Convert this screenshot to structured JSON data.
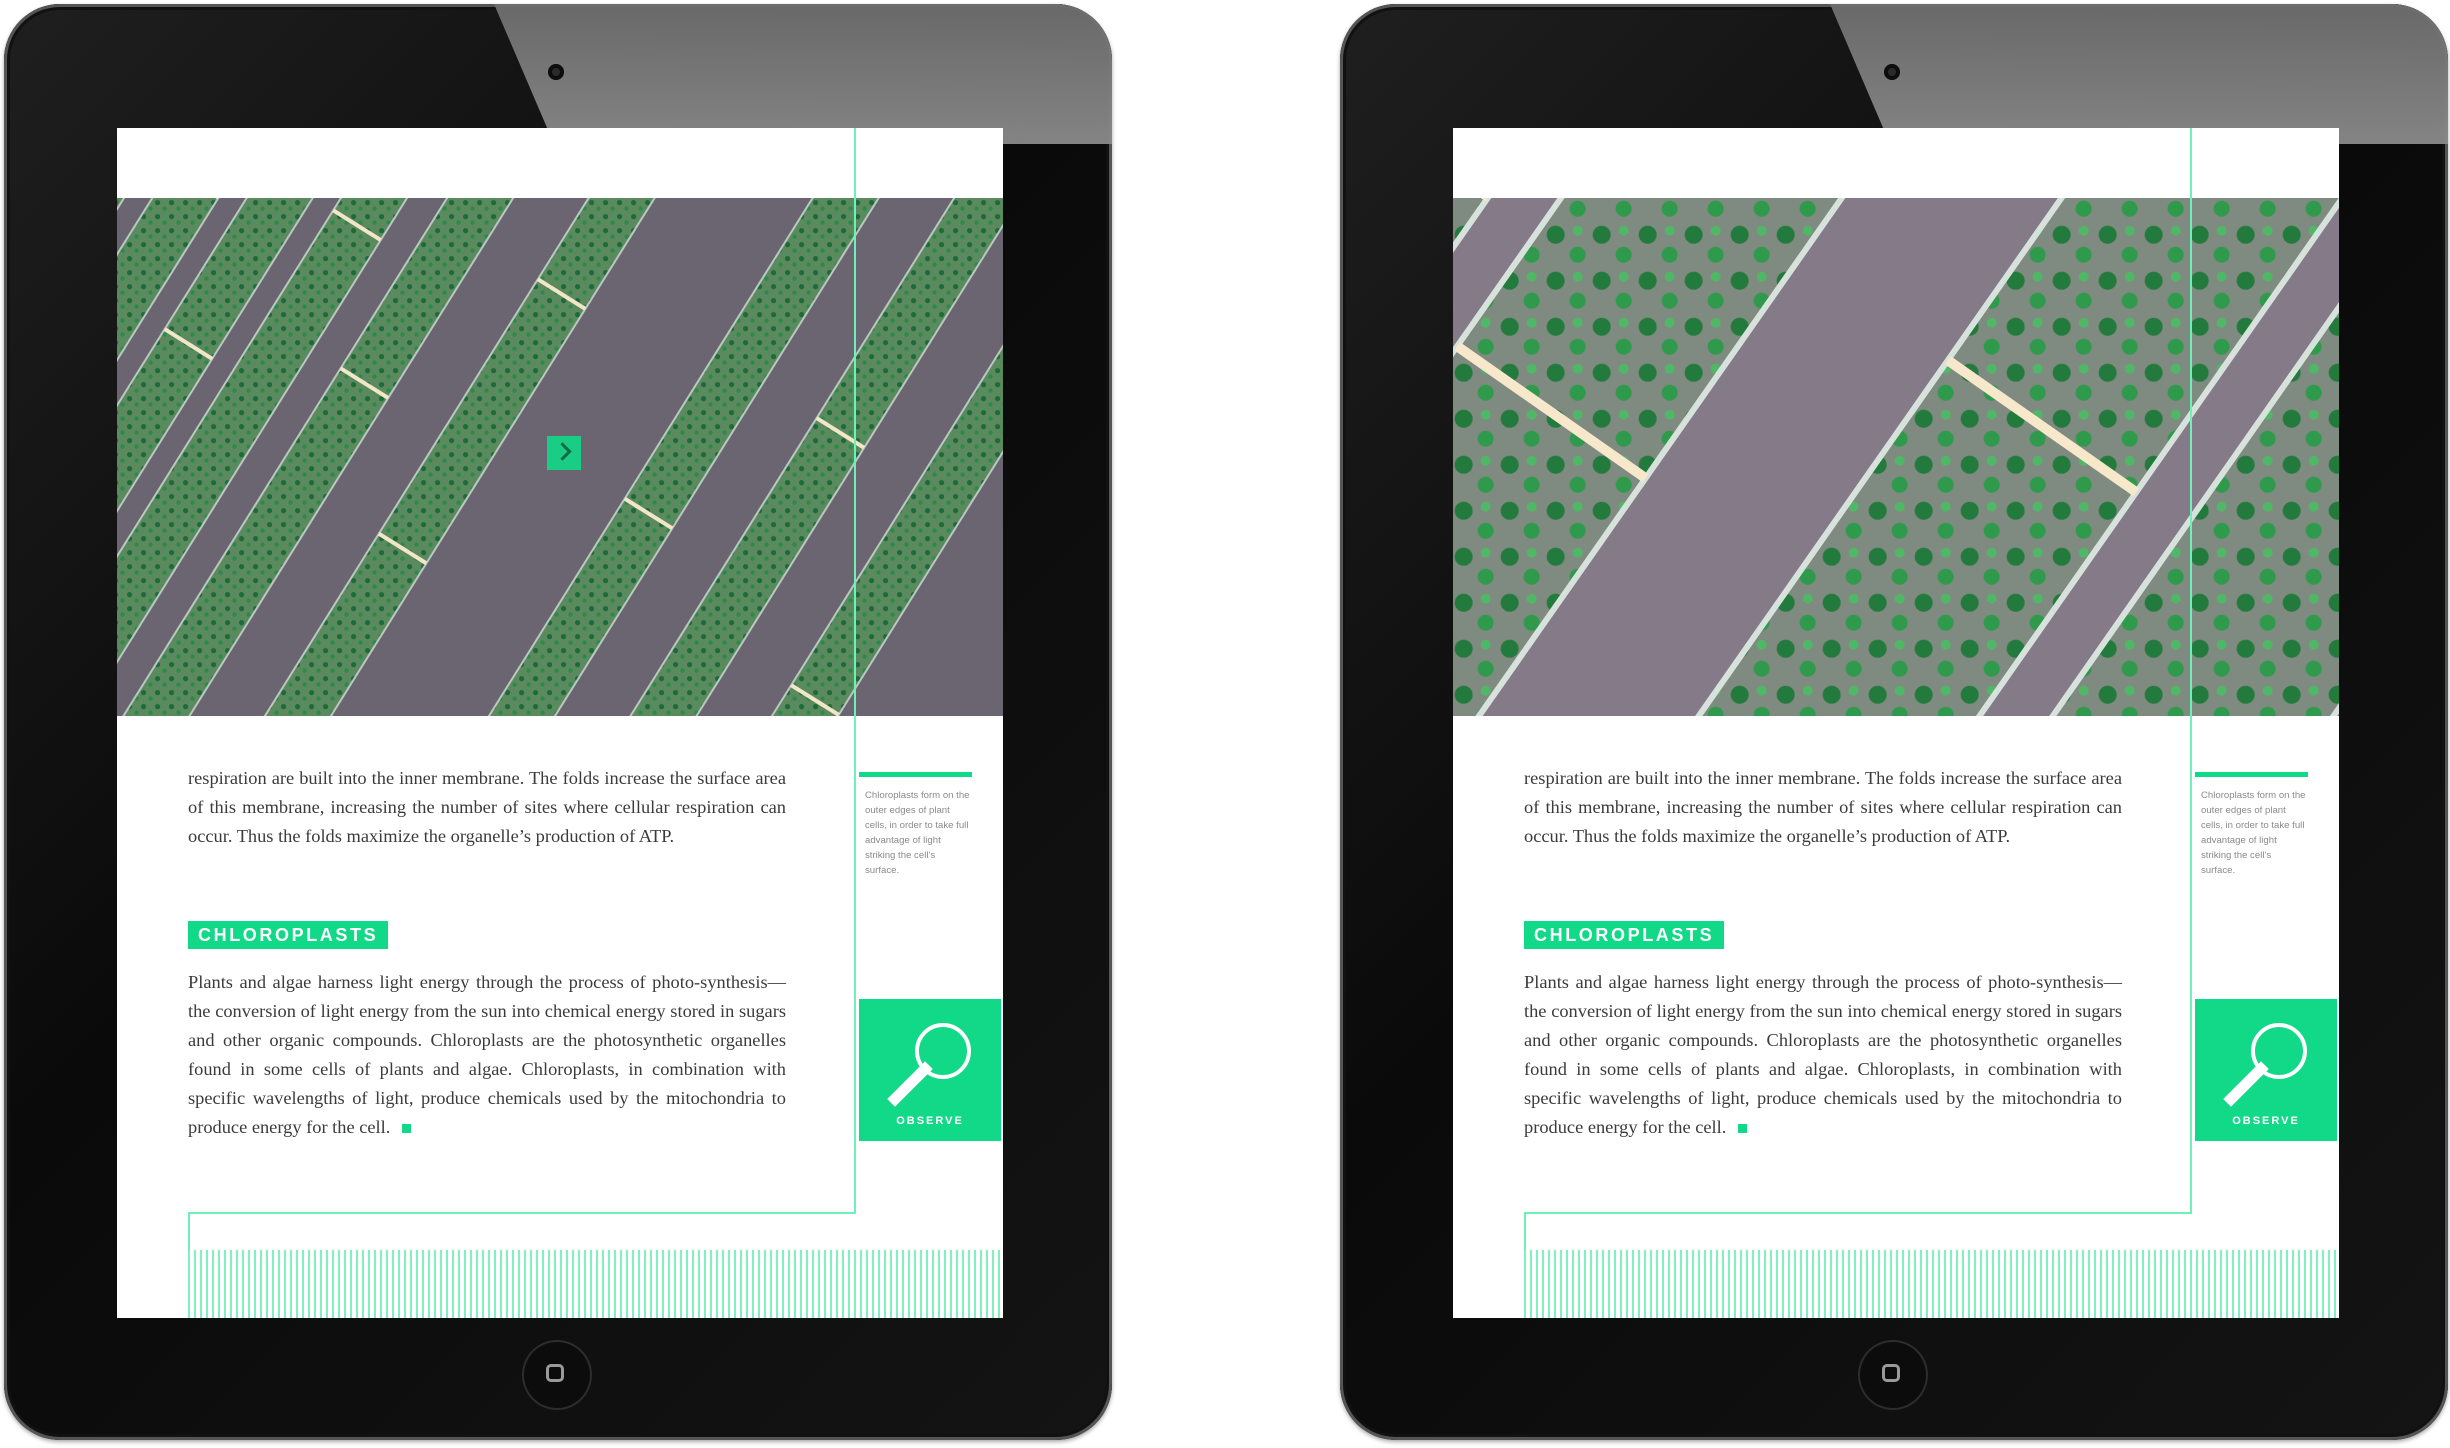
{
  "pages": [
    {
      "view": "overview",
      "body_para_1": "respiration are built into the inner membrane. The folds increase the surface area of this membrane, increasing the number of sites where cellular respiration can occur. Thus the folds maximize the organelle’s production of ATP.",
      "section_heading": "CHLOROPLASTS",
      "body_para_2": "Plants and algae harness light energy through the process of photo-synthesis—the conversion of light energy from the sun into chemical energy stored in sugars and other organic compounds. Chloroplasts are the photosynthetic organelles found in some cells of plants and algae. Chloroplasts, in combination with specific wavelengths of light, produce chemicals used by the mitochondria to produce energy for the cell.",
      "sidebar_note": "Chloroplasts form on the outer edges of plant cells, in order to take full advantage of light striking the cell’s surface.",
      "observe_label": "OBSERVE"
    },
    {
      "view": "zoomed",
      "body_para_1": "respiration are built into the inner membrane. The folds increase the surface area of this membrane, increasing the number of sites where cellular respiration can occur. Thus the folds maximize the organelle’s production of ATP.",
      "section_heading": "CHLOROPLASTS",
      "body_para_2": "Plants and algae harness light energy through the process of photo-synthesis—the conversion of light energy from the sun into chemical energy stored in sugars and other organic compounds. Chloroplasts are the photosynthetic organelles found in some cells of plants and algae. Chloroplasts, in combination with specific wavelengths of light, produce chemicals used by the mitochondria to produce energy for the cell.",
      "sidebar_note": "Chloroplasts form on the outer edges of plant cells, in order to take full advantage of light striking the cell’s surface.",
      "observe_label": "OBSERVE"
    }
  ],
  "colors": {
    "accent": "#12d988",
    "rule": "#6ff0b8",
    "body_text": "#3b3b3b",
    "photo_bg": "#6b6572"
  },
  "icons": [
    "magnifier-icon",
    "home-button-icon",
    "camera-icon"
  ]
}
